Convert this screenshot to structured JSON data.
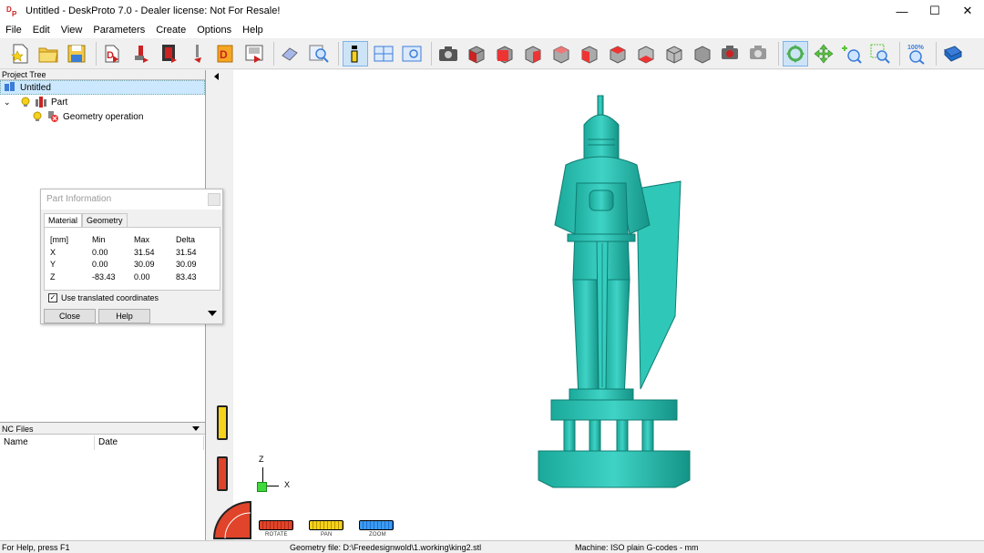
{
  "window": {
    "title": "Untitled - DeskProto 7.0 - Dealer license: Not For Resale!",
    "minimize": "—",
    "maximize": "☐",
    "close": "✕"
  },
  "menu": [
    "File",
    "Edit",
    "View",
    "Parameters",
    "Create",
    "Options",
    "Help"
  ],
  "toolbar": {
    "zoom_label": "100%"
  },
  "project_tree": {
    "header": "Project Tree",
    "root": "Untitled",
    "part": "Part",
    "geometry_operation": "Geometry operation"
  },
  "nc_files": {
    "header": "NC Files",
    "columns": [
      "Name",
      "Date"
    ]
  },
  "part_info_dialog": {
    "title": "Part Information",
    "tabs": [
      "Material",
      "Geometry"
    ],
    "header_row": [
      "[mm]",
      "Min",
      "Max",
      "Delta"
    ],
    "rows": [
      [
        "X",
        "0.00",
        "31.54",
        "31.54"
      ],
      [
        "Y",
        "0.00",
        "30.09",
        "30.09"
      ],
      [
        "Z",
        "-83.43",
        "0.00",
        "83.43"
      ]
    ],
    "checkbox_label": "Use translated coordinates",
    "checkbox_checked": true,
    "close_button": "Close",
    "help_button": "Help"
  },
  "viewport": {
    "axis_z": "Z",
    "axis_x": "X",
    "model_color": "#2ec4b6",
    "rotate_label": "ROTATE",
    "pan_label": "PAN",
    "zoom_label": "ZOOM"
  },
  "status": {
    "help": "For Help, press F1",
    "geometry_file": "Geometry file: D:\\Freedesignwold\\1.working\\king2.stl",
    "machine": "Machine: ISO plain G-codes - mm"
  }
}
